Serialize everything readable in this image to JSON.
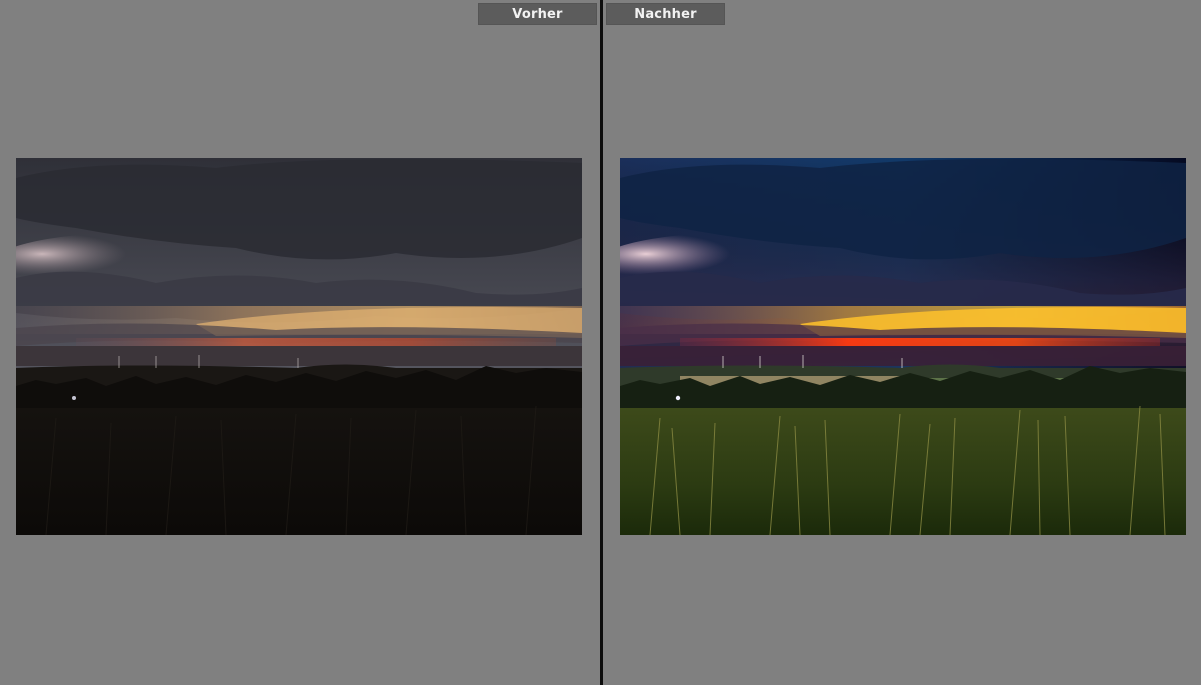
{
  "compare": {
    "before_label": "Vorher",
    "after_label": "Nachher"
  },
  "photos": {
    "before": {
      "description_icon": "landscape-photo-icon",
      "sky_top": "#35363e",
      "sky_mid": "#5a5b63",
      "glow": "#e8b06a",
      "red_band": "#c84a2f",
      "ground": "#0f0d0b"
    },
    "after": {
      "description_icon": "landscape-photo-icon",
      "sky_top": "#0b2a4f",
      "sky_mid": "#2a2f4a",
      "glow": "#ffc12a",
      "red_band": "#ff3a12",
      "ground": "#2d3b14"
    }
  }
}
